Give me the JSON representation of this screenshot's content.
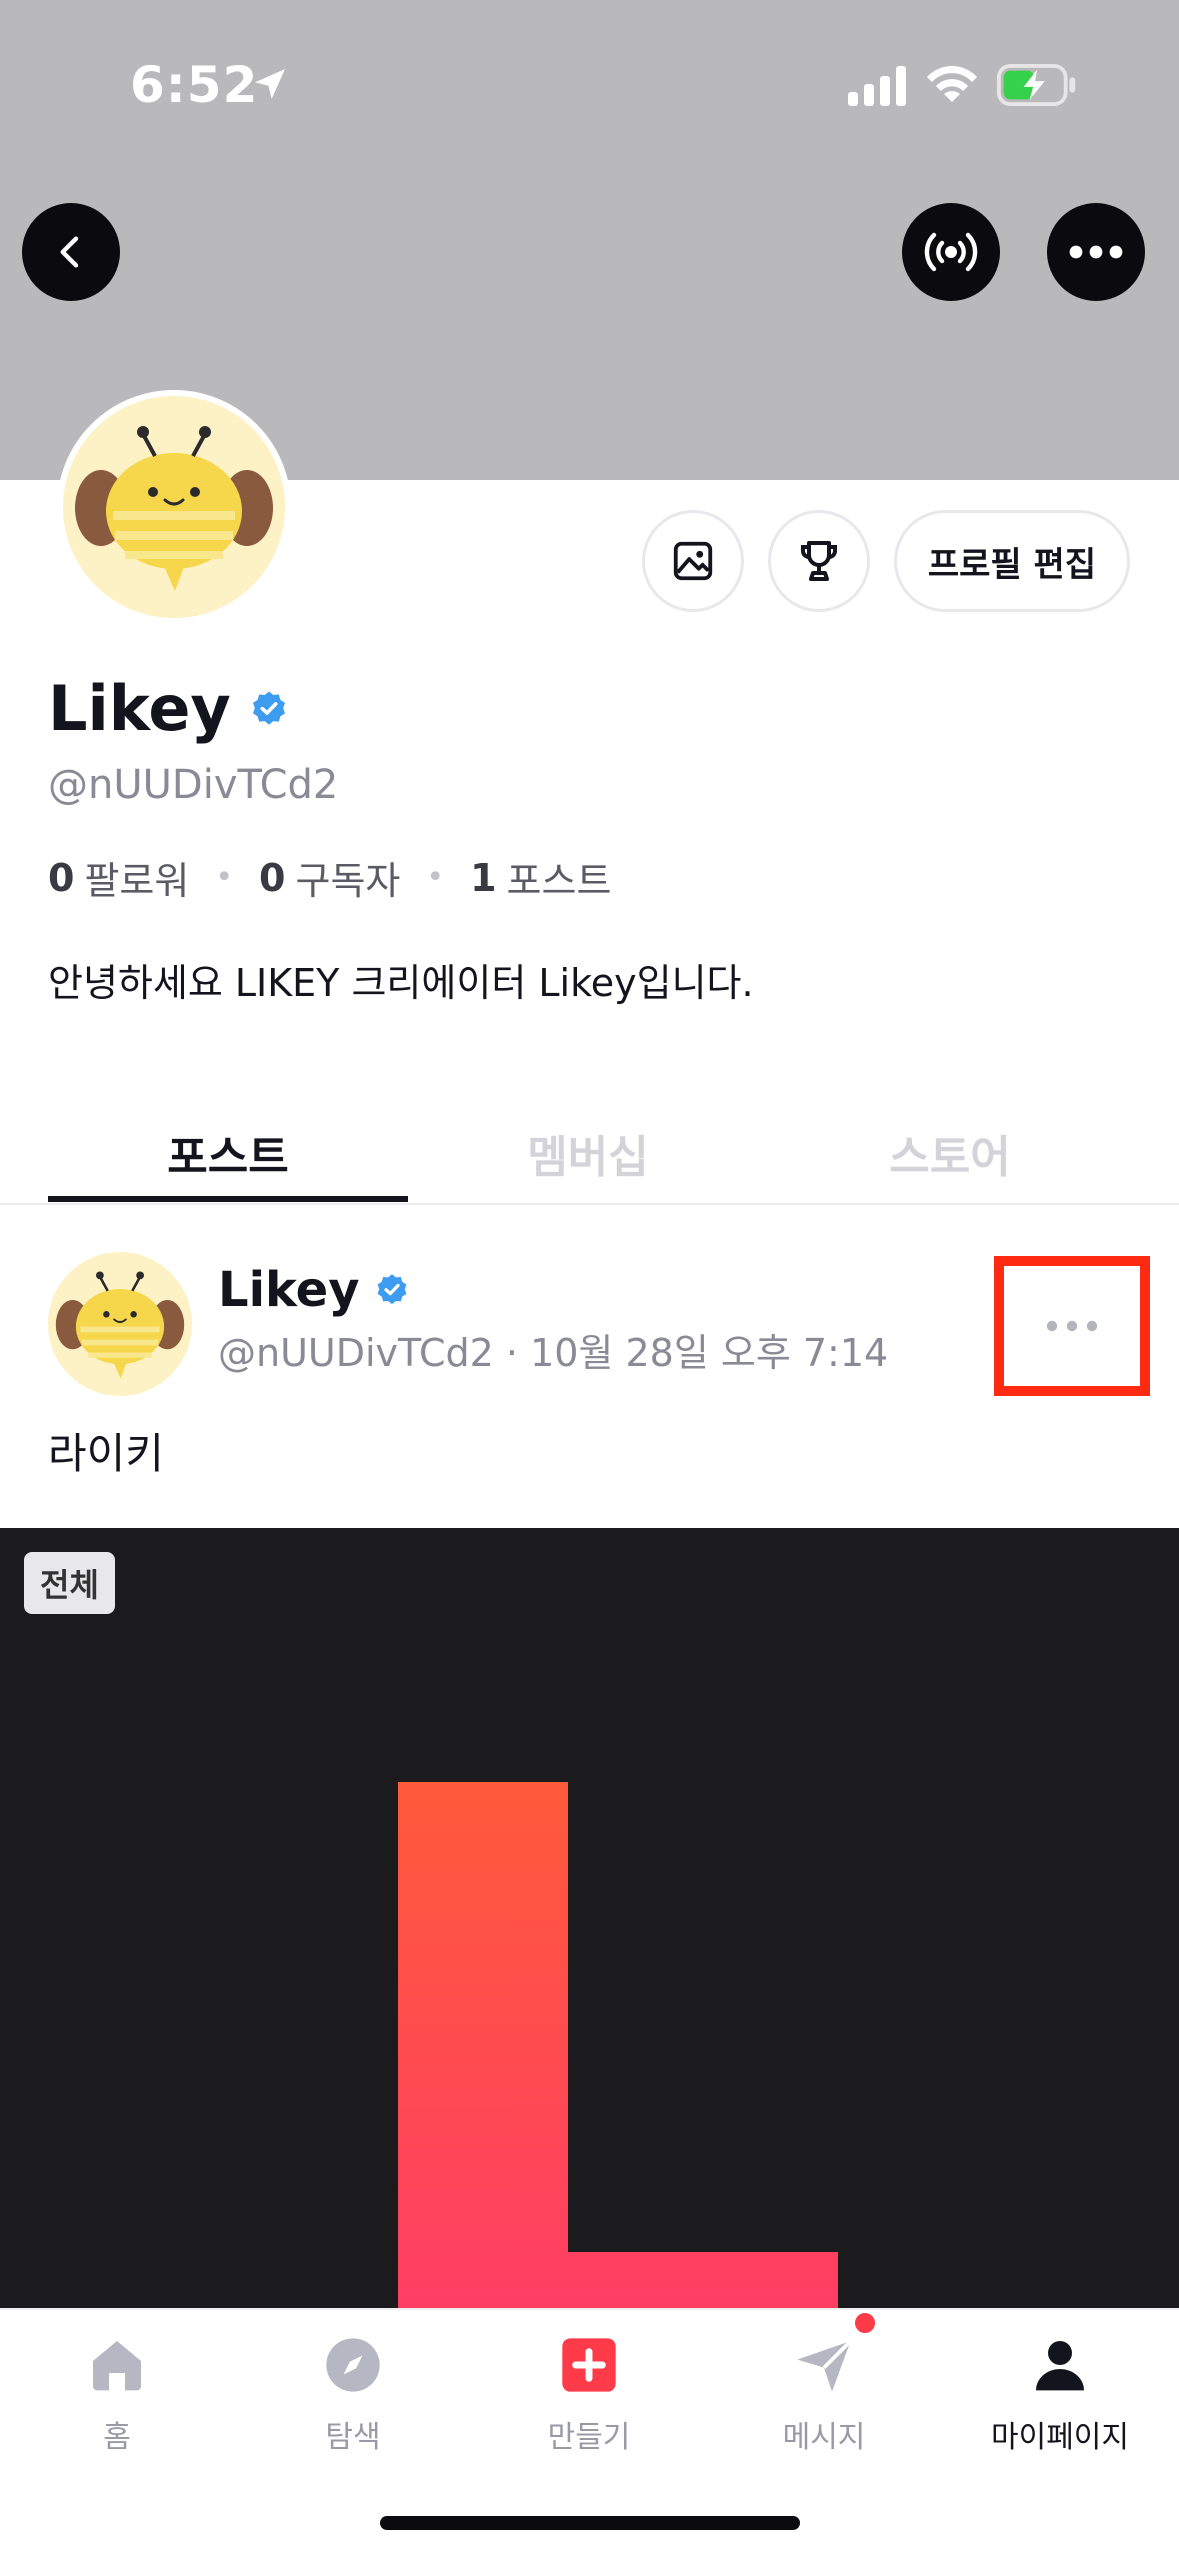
{
  "status_bar": {
    "time": "6:52"
  },
  "header": {
    "back_icon": "chevron-left-icon",
    "live_icon": "broadcast-icon",
    "more_icon": "more-horizontal-icon"
  },
  "profile": {
    "name": "Likey",
    "handle": "@nUUDivTCd2",
    "edit_label": "프로필 편집",
    "stats": {
      "followers_count": "0",
      "followers_label": "팔로워",
      "subscribers_count": "0",
      "subscribers_label": "구독자",
      "posts_count": "1",
      "posts_label": "포스트"
    },
    "bio": "안녕하세요 LIKEY 크리에이터 Likey입니다."
  },
  "tabs": [
    {
      "label": "포스트",
      "active": true
    },
    {
      "label": "멤버십",
      "active": false
    },
    {
      "label": "스토어",
      "active": false
    }
  ],
  "post": {
    "author": "Likey",
    "meta": "@nUUDivTCd2 · 10월 28일 오후 7:14",
    "text": "라이키",
    "media_badge": "전체"
  },
  "bottom_nav": [
    {
      "label": "홈",
      "icon": "home-icon"
    },
    {
      "label": "탐색",
      "icon": "compass-icon"
    },
    {
      "label": "만들기",
      "icon": "plus-icon"
    },
    {
      "label": "메시지",
      "icon": "send-icon"
    },
    {
      "label": "마이페이지",
      "icon": "user-icon",
      "active": true
    }
  ],
  "colors": {
    "accent_red": "#ff3b4a",
    "verified_blue": "#3d9cf0",
    "highlight_box": "#ff2a12"
  }
}
